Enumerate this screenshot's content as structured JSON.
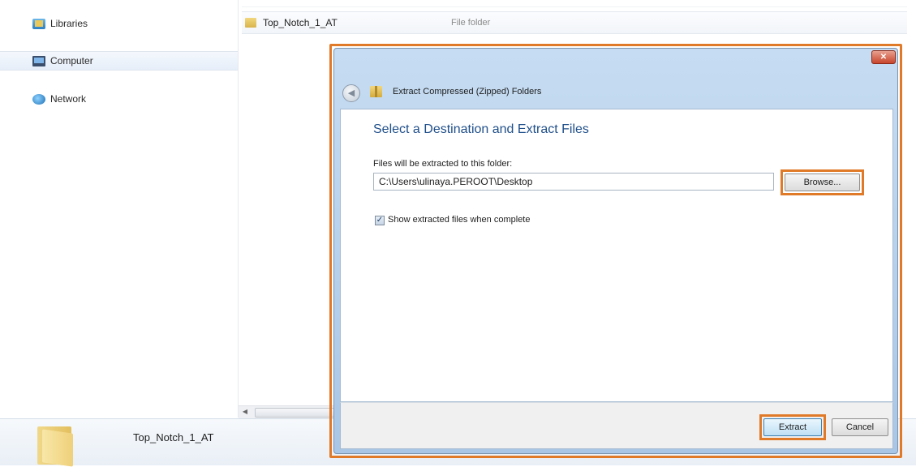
{
  "sidebar": {
    "items": [
      {
        "label": "Libraries",
        "icon": "libraries-icon"
      },
      {
        "label": "Computer",
        "icon": "computer-icon"
      },
      {
        "label": "Network",
        "icon": "network-icon"
      }
    ]
  },
  "file_list": {
    "rows": [
      {
        "name": "Top_Notch_1_AT",
        "type": "File folder",
        "icon": "folder-icon"
      }
    ]
  },
  "details_pane": {
    "name": "Top_Notch_1_AT",
    "icon": "folder-icon"
  },
  "dialog": {
    "title": "Extract Compressed (Zipped) Folders",
    "close_label": "✕",
    "heading": "Select a Destination and Extract Files",
    "destination_label": "Files will be extracted to this folder:",
    "destination_value": "C:\\Users\\ulinaya.PEROOT\\Desktop",
    "browse_label": "Browse...",
    "show_files_label": "Show extracted files when complete",
    "show_files_checked": true,
    "extract_label": "Extract",
    "cancel_label": "Cancel"
  },
  "colors": {
    "highlight": "#e07a28",
    "heading": "#1f4f8a"
  }
}
